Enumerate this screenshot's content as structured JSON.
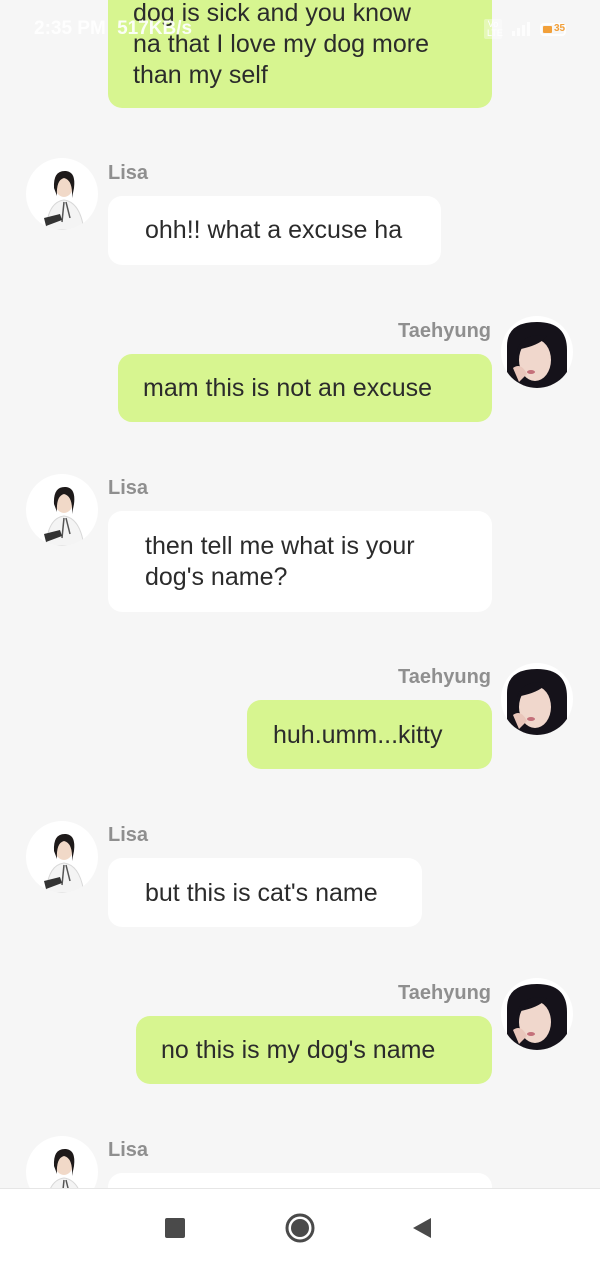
{
  "status_bar": {
    "time": "2:35 PM",
    "speed": "517KB/s",
    "network_badge": "Vo LTE",
    "battery_level": "35",
    "battery_color": "#f2a03a"
  },
  "colors": {
    "background": "#f6f6f6",
    "outgoing_bubble": "#d7f590",
    "incoming_bubble": "#ffffff",
    "sender_name": "#8f8f8f"
  },
  "messages": [
    {
      "sender": "",
      "direction": "outgoing",
      "lines": [
        "dog is sick and you know",
        "na that I love my dog more",
        "than my self"
      ]
    },
    {
      "sender": "Lisa",
      "direction": "incoming",
      "lines": [
        "ohh!! what a excuse ha"
      ]
    },
    {
      "sender": "Taehyung",
      "direction": "outgoing",
      "lines": [
        "mam this is not an excuse"
      ]
    },
    {
      "sender": "Lisa",
      "direction": "incoming",
      "lines": [
        "then tell me what is your",
        "dog's name?"
      ]
    },
    {
      "sender": "Taehyung",
      "direction": "outgoing",
      "lines": [
        "huh.umm...kitty"
      ]
    },
    {
      "sender": "Lisa",
      "direction": "incoming",
      "lines": [
        "but this is cat's name"
      ]
    },
    {
      "sender": "Taehyung",
      "direction": "outgoing",
      "lines": [
        "no this is my dog's name"
      ]
    },
    {
      "sender": "Lisa",
      "direction": "incoming",
      "lines": []
    }
  ],
  "avatars": {
    "lisa": "doctor-avatar-icon",
    "taehyung": "man-portrait-avatar-icon"
  },
  "nav_bar": {
    "recents_icon": "square-recents-icon",
    "home_icon": "circle-home-icon",
    "back_icon": "triangle-back-icon"
  }
}
